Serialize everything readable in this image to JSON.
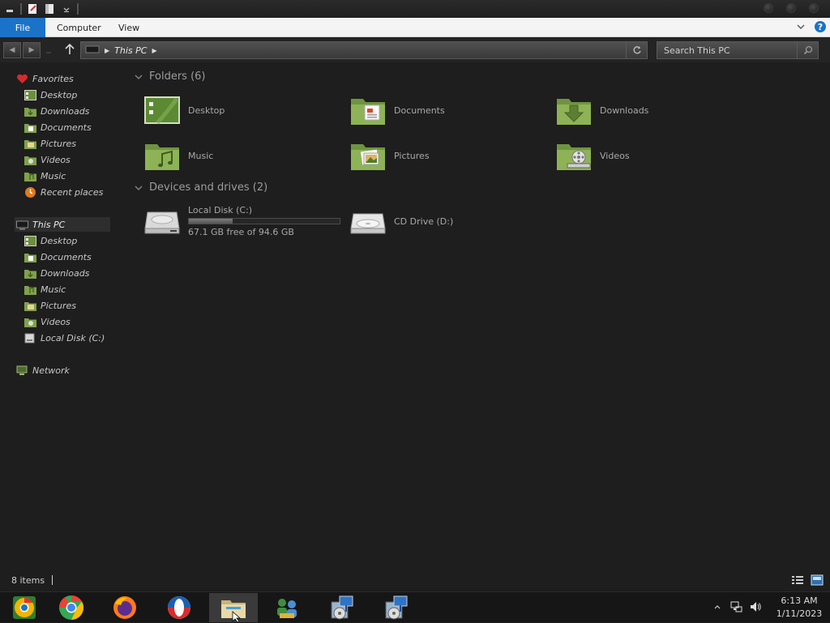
{
  "ribbon": {
    "file_tab": "File",
    "tabs": [
      "Computer",
      "View"
    ]
  },
  "address": {
    "location": "This PC",
    "search_placeholder": "Search This PC"
  },
  "nav_pane": {
    "favorites": {
      "label": "Favorites",
      "items": [
        "Desktop",
        "Downloads",
        "Documents",
        "Pictures",
        "Videos",
        "Music",
        "Recent places"
      ]
    },
    "this_pc": {
      "label": "This PC",
      "items": [
        "Desktop",
        "Documents",
        "Downloads",
        "Music",
        "Pictures",
        "Videos",
        "Local Disk (C:)"
      ]
    },
    "network": "Network"
  },
  "content": {
    "folders_header": "Folders (6)",
    "folders": [
      "Desktop",
      "Documents",
      "Downloads",
      "Music",
      "Pictures",
      "Videos"
    ],
    "devices_header": "Devices and drives (2)",
    "drives": [
      {
        "name": "Local Disk (C:)",
        "free_text": "67.1 GB free of 94.6 GB",
        "used_fraction": 0.29
      },
      {
        "name": "CD Drive (D:)"
      }
    ]
  },
  "status_bar": {
    "item_count": "8 items"
  },
  "taskbar": {
    "apps": [
      "chrome-canary",
      "chrome",
      "firefox",
      "opera",
      "file-explorer",
      "network-users",
      "installer-1",
      "installer-2"
    ],
    "time": "6:13 AM",
    "date": "1/11/2023"
  },
  "colors": {
    "folder_green": "#7fa24a",
    "accent_blue": "#1a73c8"
  }
}
